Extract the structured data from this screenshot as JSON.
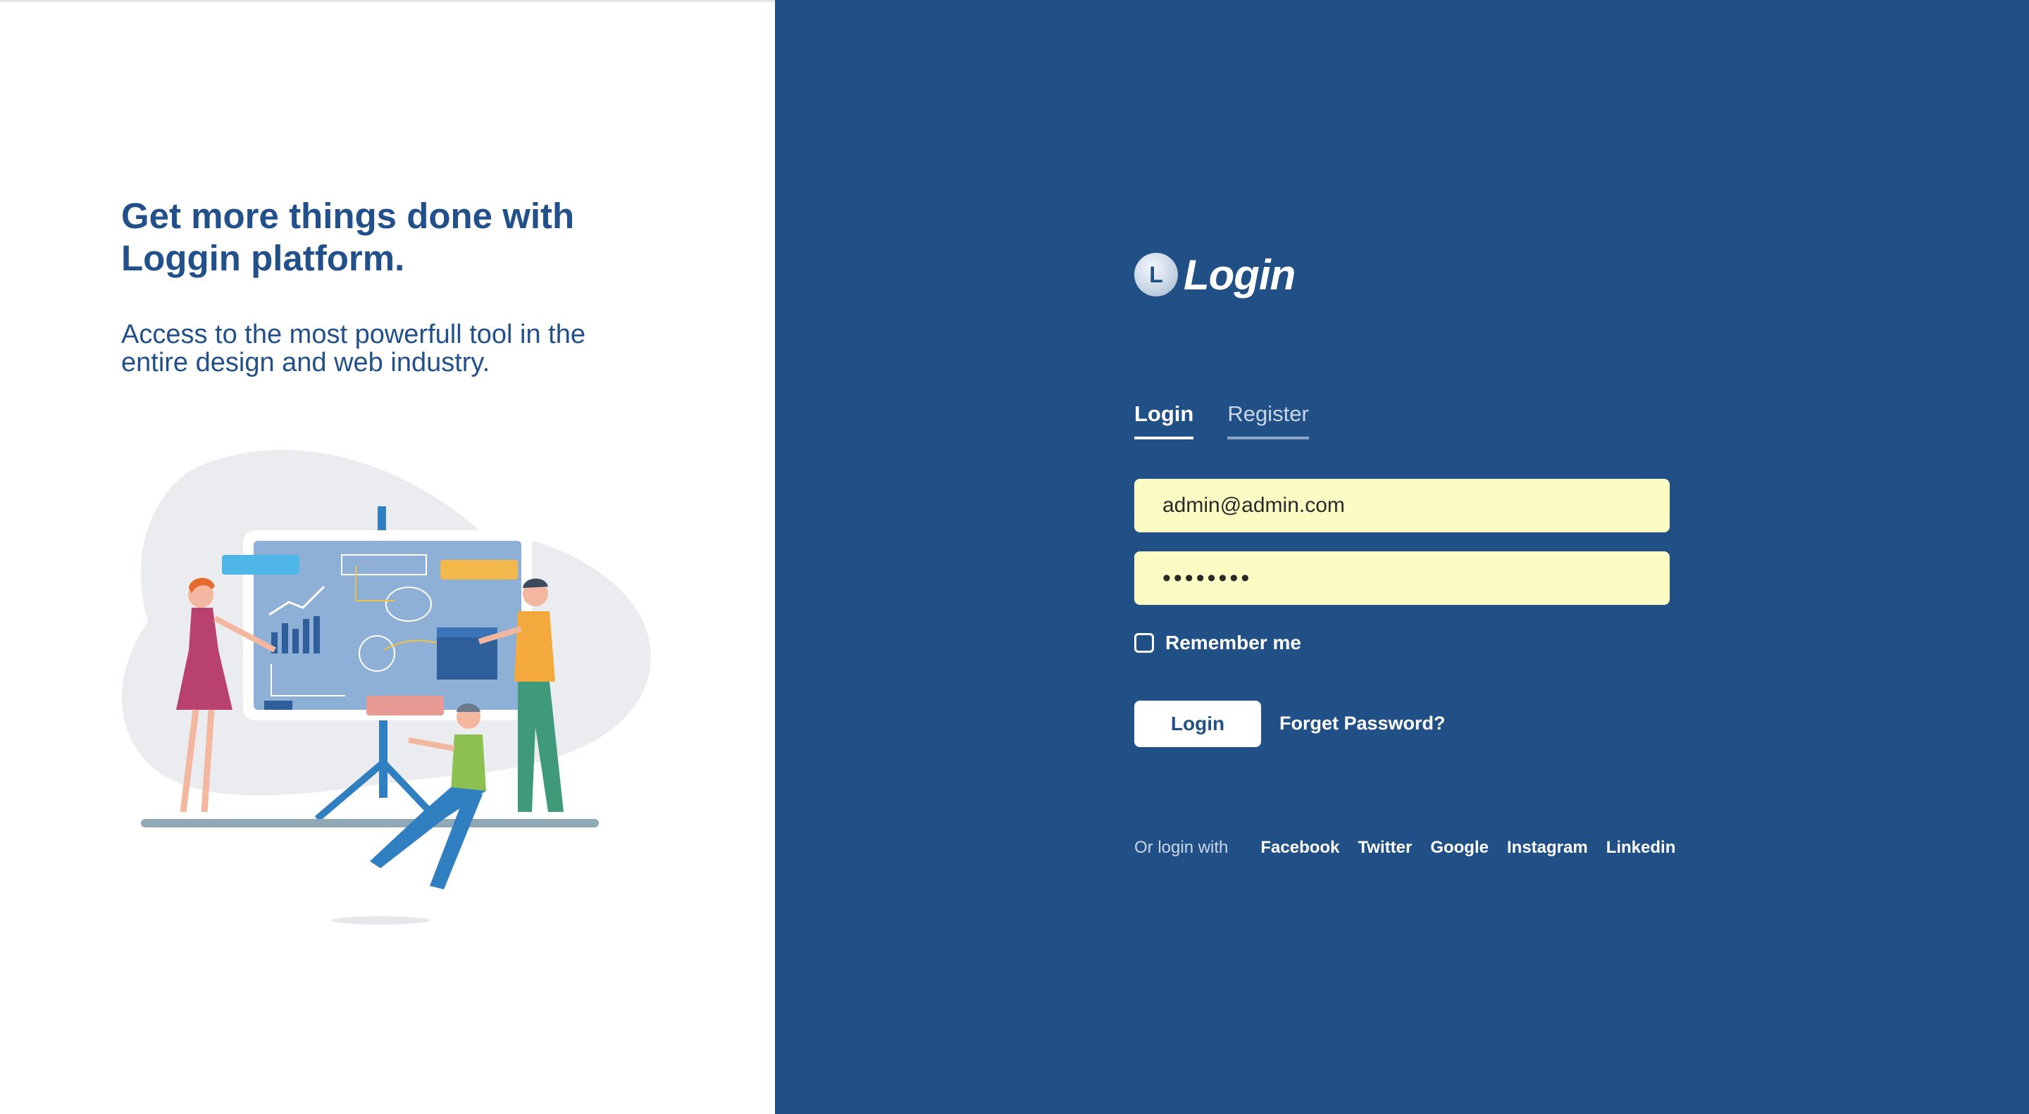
{
  "hero": {
    "headline_line1": "Get more things done with",
    "headline_line2": "Loggin platform.",
    "subtext_line1": "Access to the most powerfull tool in the",
    "subtext_line2": "entire design and web industry."
  },
  "brand": {
    "mark": "L",
    "name": "Login"
  },
  "tabs": [
    {
      "label": "Login",
      "active": true
    },
    {
      "label": "Register",
      "active": false
    }
  ],
  "form": {
    "email_value": "admin@admin.com",
    "password_value": "••••••••",
    "remember_label": "Remember me",
    "remember_checked": false,
    "login_button": "Login",
    "forget_link": "Forget Password?"
  },
  "social": {
    "label": "Or login with",
    "providers": [
      "Facebook",
      "Twitter",
      "Google",
      "Instagram",
      "Linkedin"
    ]
  },
  "colors": {
    "primary": "#215087",
    "input_bg": "#fafcc4",
    "headline": "#22508a"
  },
  "illustration": {
    "icon": "team-presentation-illustration"
  }
}
